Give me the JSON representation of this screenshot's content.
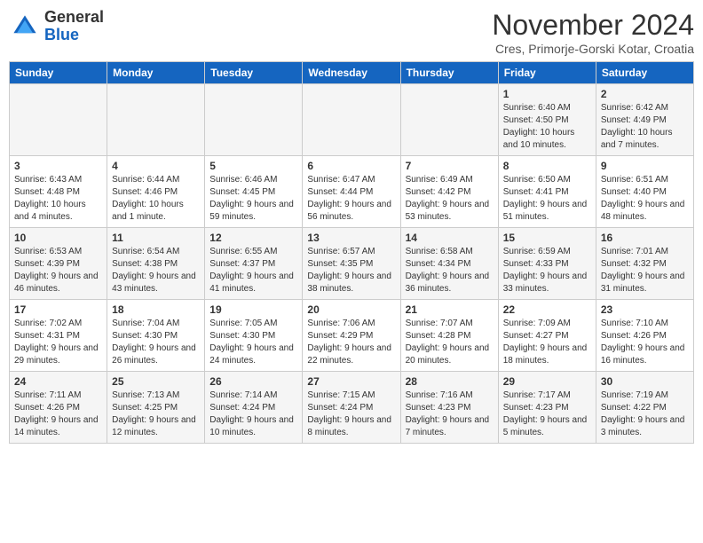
{
  "header": {
    "logo_general": "General",
    "logo_blue": "Blue",
    "month_title": "November 2024",
    "subtitle": "Cres, Primorje-Gorski Kotar, Croatia"
  },
  "weekdays": [
    "Sunday",
    "Monday",
    "Tuesday",
    "Wednesday",
    "Thursday",
    "Friday",
    "Saturday"
  ],
  "weeks": [
    [
      {
        "day": "",
        "info": ""
      },
      {
        "day": "",
        "info": ""
      },
      {
        "day": "",
        "info": ""
      },
      {
        "day": "",
        "info": ""
      },
      {
        "day": "",
        "info": ""
      },
      {
        "day": "1",
        "info": "Sunrise: 6:40 AM\nSunset: 4:50 PM\nDaylight: 10 hours and 10 minutes."
      },
      {
        "day": "2",
        "info": "Sunrise: 6:42 AM\nSunset: 4:49 PM\nDaylight: 10 hours and 7 minutes."
      }
    ],
    [
      {
        "day": "3",
        "info": "Sunrise: 6:43 AM\nSunset: 4:48 PM\nDaylight: 10 hours and 4 minutes."
      },
      {
        "day": "4",
        "info": "Sunrise: 6:44 AM\nSunset: 4:46 PM\nDaylight: 10 hours and 1 minute."
      },
      {
        "day": "5",
        "info": "Sunrise: 6:46 AM\nSunset: 4:45 PM\nDaylight: 9 hours and 59 minutes."
      },
      {
        "day": "6",
        "info": "Sunrise: 6:47 AM\nSunset: 4:44 PM\nDaylight: 9 hours and 56 minutes."
      },
      {
        "day": "7",
        "info": "Sunrise: 6:49 AM\nSunset: 4:42 PM\nDaylight: 9 hours and 53 minutes."
      },
      {
        "day": "8",
        "info": "Sunrise: 6:50 AM\nSunset: 4:41 PM\nDaylight: 9 hours and 51 minutes."
      },
      {
        "day": "9",
        "info": "Sunrise: 6:51 AM\nSunset: 4:40 PM\nDaylight: 9 hours and 48 minutes."
      }
    ],
    [
      {
        "day": "10",
        "info": "Sunrise: 6:53 AM\nSunset: 4:39 PM\nDaylight: 9 hours and 46 minutes."
      },
      {
        "day": "11",
        "info": "Sunrise: 6:54 AM\nSunset: 4:38 PM\nDaylight: 9 hours and 43 minutes."
      },
      {
        "day": "12",
        "info": "Sunrise: 6:55 AM\nSunset: 4:37 PM\nDaylight: 9 hours and 41 minutes."
      },
      {
        "day": "13",
        "info": "Sunrise: 6:57 AM\nSunset: 4:35 PM\nDaylight: 9 hours and 38 minutes."
      },
      {
        "day": "14",
        "info": "Sunrise: 6:58 AM\nSunset: 4:34 PM\nDaylight: 9 hours and 36 minutes."
      },
      {
        "day": "15",
        "info": "Sunrise: 6:59 AM\nSunset: 4:33 PM\nDaylight: 9 hours and 33 minutes."
      },
      {
        "day": "16",
        "info": "Sunrise: 7:01 AM\nSunset: 4:32 PM\nDaylight: 9 hours and 31 minutes."
      }
    ],
    [
      {
        "day": "17",
        "info": "Sunrise: 7:02 AM\nSunset: 4:31 PM\nDaylight: 9 hours and 29 minutes."
      },
      {
        "day": "18",
        "info": "Sunrise: 7:04 AM\nSunset: 4:30 PM\nDaylight: 9 hours and 26 minutes."
      },
      {
        "day": "19",
        "info": "Sunrise: 7:05 AM\nSunset: 4:30 PM\nDaylight: 9 hours and 24 minutes."
      },
      {
        "day": "20",
        "info": "Sunrise: 7:06 AM\nSunset: 4:29 PM\nDaylight: 9 hours and 22 minutes."
      },
      {
        "day": "21",
        "info": "Sunrise: 7:07 AM\nSunset: 4:28 PM\nDaylight: 9 hours and 20 minutes."
      },
      {
        "day": "22",
        "info": "Sunrise: 7:09 AM\nSunset: 4:27 PM\nDaylight: 9 hours and 18 minutes."
      },
      {
        "day": "23",
        "info": "Sunrise: 7:10 AM\nSunset: 4:26 PM\nDaylight: 9 hours and 16 minutes."
      }
    ],
    [
      {
        "day": "24",
        "info": "Sunrise: 7:11 AM\nSunset: 4:26 PM\nDaylight: 9 hours and 14 minutes."
      },
      {
        "day": "25",
        "info": "Sunrise: 7:13 AM\nSunset: 4:25 PM\nDaylight: 9 hours and 12 minutes."
      },
      {
        "day": "26",
        "info": "Sunrise: 7:14 AM\nSunset: 4:24 PM\nDaylight: 9 hours and 10 minutes."
      },
      {
        "day": "27",
        "info": "Sunrise: 7:15 AM\nSunset: 4:24 PM\nDaylight: 9 hours and 8 minutes."
      },
      {
        "day": "28",
        "info": "Sunrise: 7:16 AM\nSunset: 4:23 PM\nDaylight: 9 hours and 7 minutes."
      },
      {
        "day": "29",
        "info": "Sunrise: 7:17 AM\nSunset: 4:23 PM\nDaylight: 9 hours and 5 minutes."
      },
      {
        "day": "30",
        "info": "Sunrise: 7:19 AM\nSunset: 4:22 PM\nDaylight: 9 hours and 3 minutes."
      }
    ]
  ]
}
